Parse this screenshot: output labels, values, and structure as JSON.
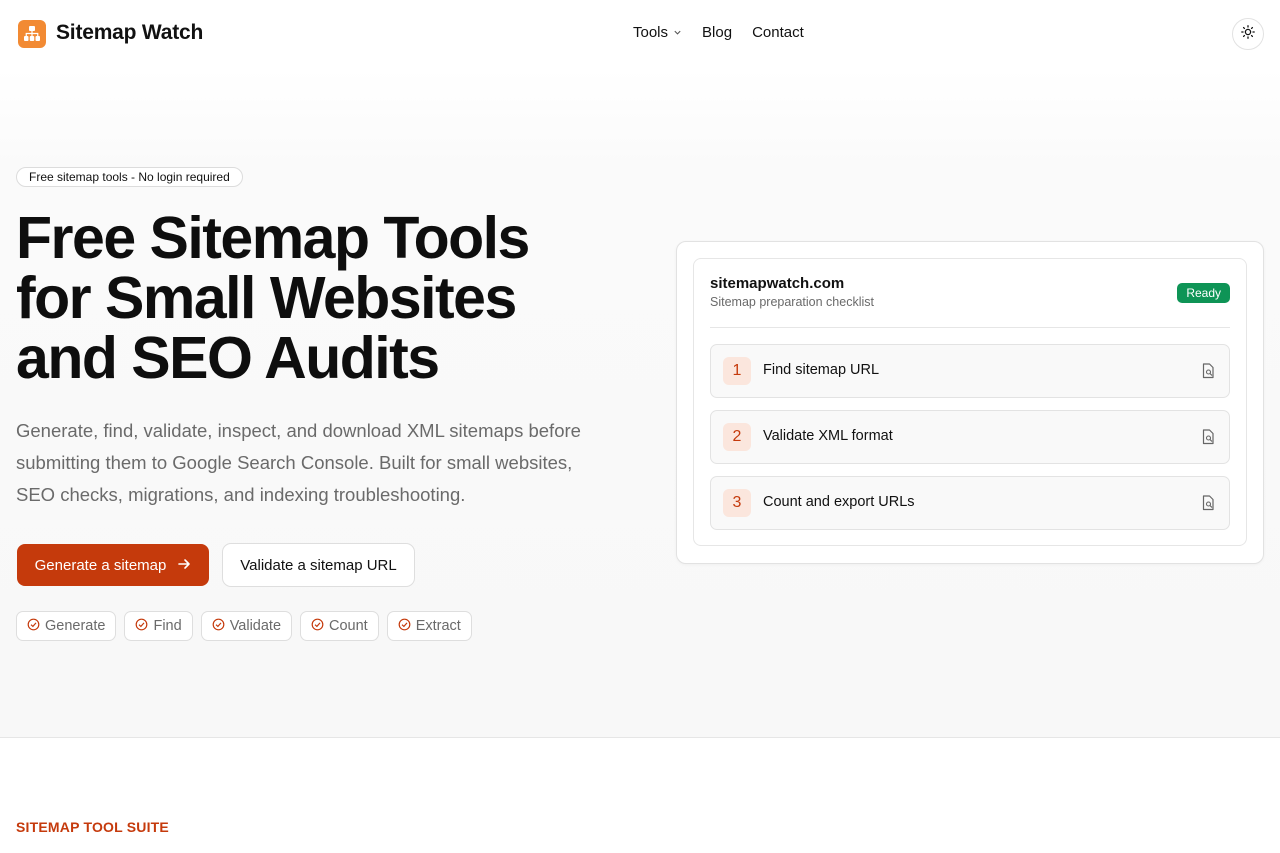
{
  "header": {
    "brand": "Sitemap Watch",
    "logo_icon": "sitemap-logo-icon",
    "nav": [
      {
        "label": "Tools",
        "has_dropdown": true
      },
      {
        "label": "Blog",
        "has_dropdown": false
      },
      {
        "label": "Contact",
        "has_dropdown": false
      }
    ],
    "theme_toggle_icon": "sun-icon"
  },
  "hero": {
    "badge": "Free sitemap tools - No login required",
    "headline_line1": "Free Sitemap Tools",
    "headline_line2": "for Small Websites",
    "headline_line3": "and SEO Audits",
    "subtext": "Generate, find, validate, inspect, and download XML sitemaps before submitting them to Google Search Console. Built for small websites, SEO checks, migrations, and indexing troubleshooting.",
    "primary_button": "Generate a sitemap",
    "secondary_button": "Validate a sitemap URL",
    "chips": [
      "Generate",
      "Find",
      "Validate",
      "Count",
      "Extract"
    ]
  },
  "card": {
    "domain": "sitemapwatch.com",
    "subtitle": "Sitemap preparation checklist",
    "status": "Ready",
    "steps": [
      {
        "number": "1",
        "label": "Find sitemap URL"
      },
      {
        "number": "2",
        "label": "Validate XML format"
      },
      {
        "number": "3",
        "label": "Count and export URLs"
      }
    ]
  },
  "section": {
    "label": "SITEMAP TOOL SUITE"
  },
  "colors": {
    "accent": "#c53a0c",
    "logo": "#f28a33",
    "ready": "#0e9456"
  }
}
